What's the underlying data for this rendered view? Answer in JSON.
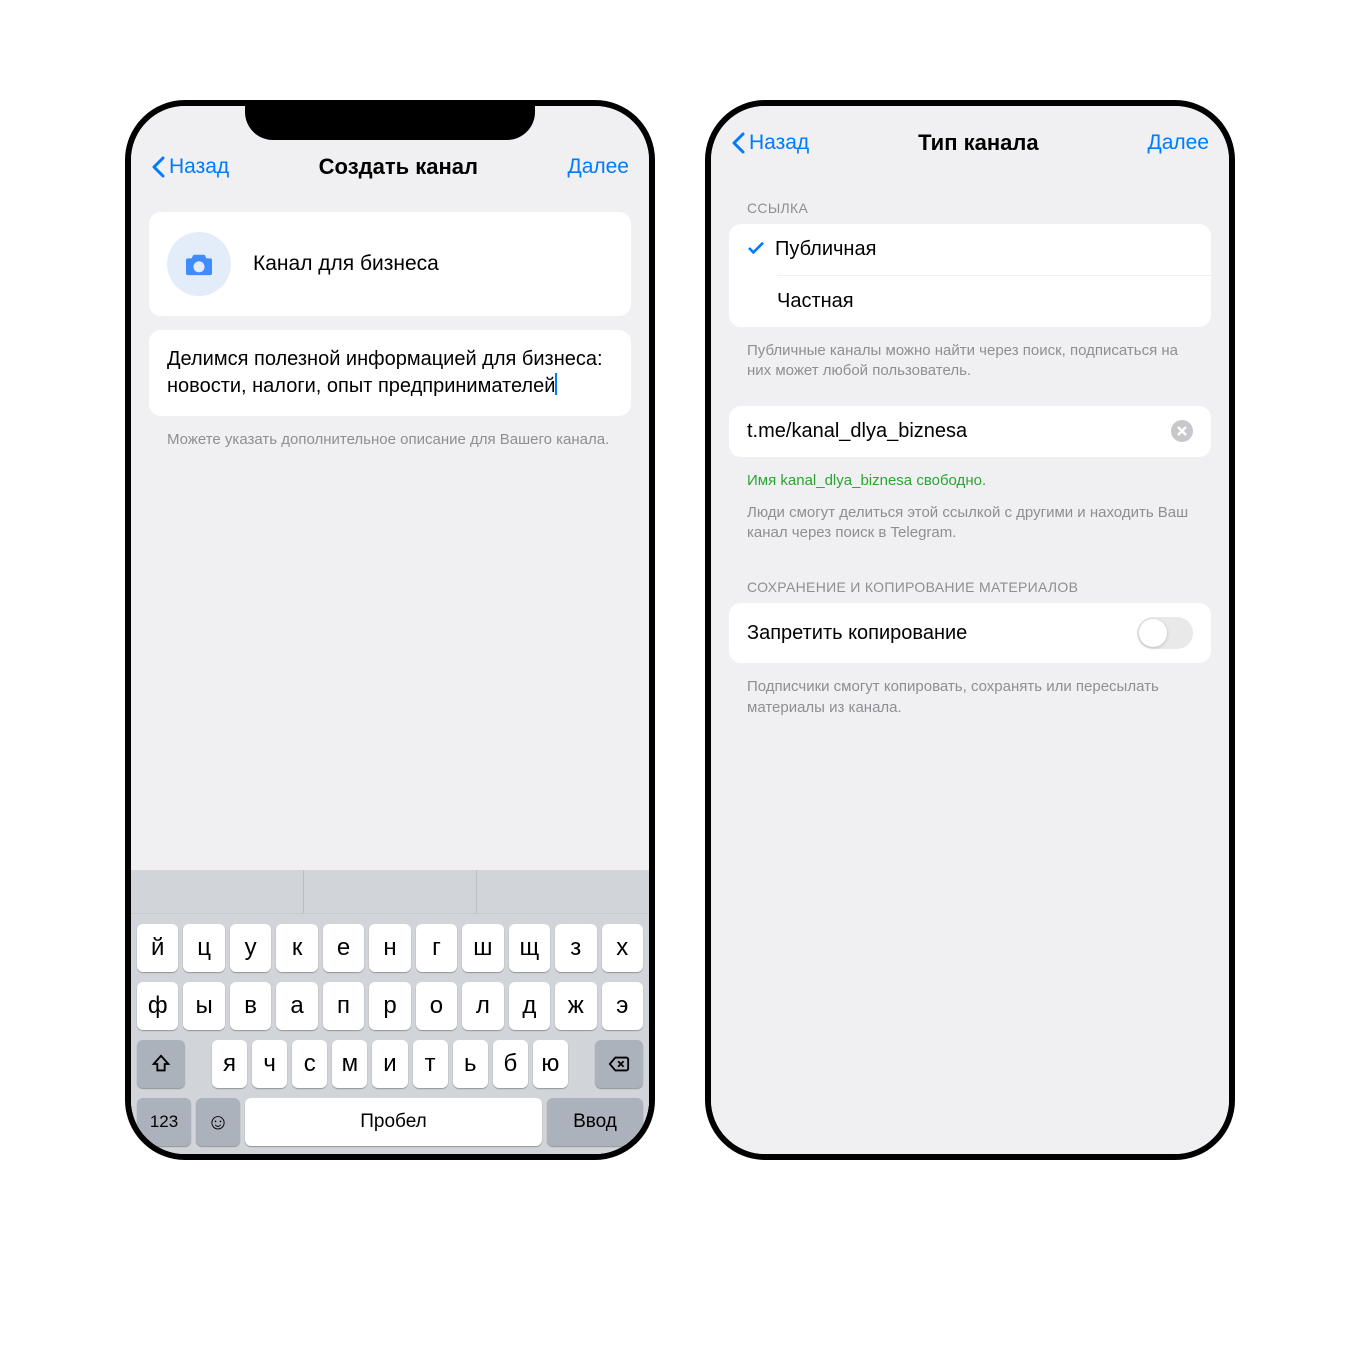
{
  "phone1": {
    "header": {
      "back": "Назад",
      "title": "Создать канал",
      "next": "Далее"
    },
    "channel_name": "Канал для бизнеса",
    "description": "Делимся полезной информацией для бизнеса: новости, налоги, опыт предпринимателей",
    "desc_hint": "Можете указать дополнительное описание для Вашего канала.",
    "keyboard": {
      "row1": [
        "й",
        "ц",
        "у",
        "к",
        "е",
        "н",
        "г",
        "ш",
        "щ",
        "з",
        "х"
      ],
      "row2": [
        "ф",
        "ы",
        "в",
        "а",
        "п",
        "р",
        "о",
        "л",
        "д",
        "ж",
        "э"
      ],
      "row3": [
        "я",
        "ч",
        "с",
        "м",
        "и",
        "т",
        "ь",
        "б",
        "ю"
      ],
      "num": "123",
      "space": "Пробел",
      "enter": "Ввод"
    }
  },
  "phone2": {
    "header": {
      "back": "Назад",
      "title": "Тип канала",
      "next": "Далее"
    },
    "link_section": "ССЫЛКА",
    "opt_public": "Публичная",
    "opt_private": "Частная",
    "link_hint1": "Публичные каналы можно найти через поиск, подписаться на них может любой пользователь.",
    "link_value": "t.me/kanal_dlya_biznesa",
    "link_available": "Имя kanal_dlya_biznesa свободно.",
    "link_hint2": "Люди смогут делиться этой ссылкой с другими и находить Ваш канал через поиск в Telegram.",
    "copy_section": "СОХРАНЕНИЕ И КОПИРОВАНИЕ МАТЕРИАЛОВ",
    "forbid_copy": "Запретить копирование",
    "copy_hint": "Подписчики смогут копировать, сохранять или пересылать материалы из канала."
  }
}
